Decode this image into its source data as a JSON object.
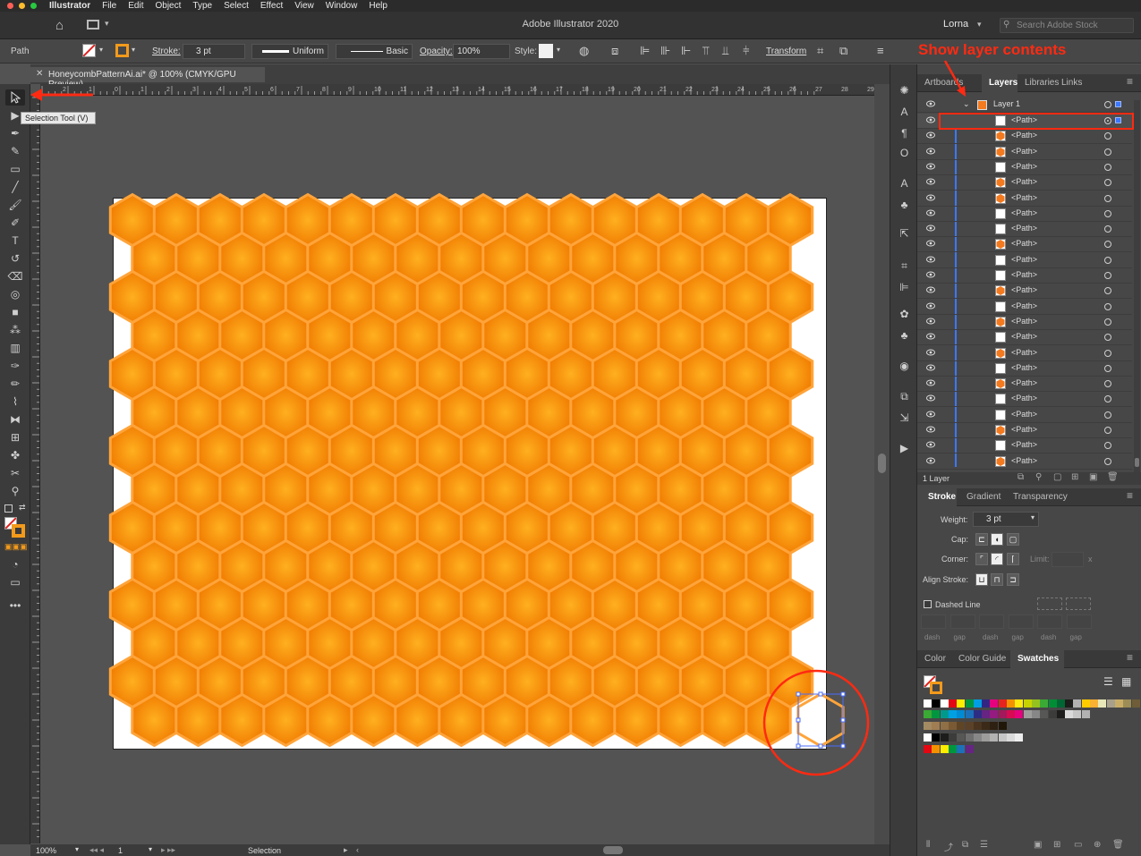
{
  "menubar": {
    "app": "Illustrator",
    "items": [
      "File",
      "Edit",
      "Object",
      "Type",
      "Select",
      "Effect",
      "View",
      "Window",
      "Help"
    ]
  },
  "appbar": {
    "title": "Adobe Illustrator 2020",
    "user": "Lorna",
    "search_placeholder": "Search Adobe Stock"
  },
  "controlbar": {
    "selection_type": "Path",
    "stroke_label": "Stroke:",
    "stroke_weight": "3 pt",
    "profile": "Uniform",
    "brush": "Basic",
    "opacity_label": "Opacity:",
    "opacity": "100%",
    "style_label": "Style:",
    "transform": "Transform"
  },
  "document": {
    "tab_title": "HoneycombPatternAi.ai* @ 100% (CMYK/GPU Preview)"
  },
  "ruler": {
    "h_ticks": [
      "2",
      "1",
      "0",
      "1",
      "2",
      "3",
      "4",
      "5",
      "6",
      "7",
      "8",
      "9",
      "10",
      "11",
      "12",
      "13",
      "14",
      "15",
      "16",
      "17",
      "18",
      "19",
      "20",
      "21",
      "22",
      "23",
      "24",
      "25",
      "26",
      "27",
      "28",
      "29"
    ]
  },
  "tooltip": "Selection Tool (V)",
  "status": {
    "zoom": "100%",
    "artboard": "1",
    "tool": "Selection"
  },
  "layers_panel": {
    "tabs": [
      "Artboards",
      "Layers",
      "Libraries",
      "Links"
    ],
    "active_tab": "Layers",
    "layer_name": "Layer 1",
    "path_label": "<Path>",
    "path_thumbs": [
      "white",
      "hex",
      "hex",
      "white",
      "hex",
      "hex",
      "white",
      "white",
      "hex",
      "white",
      "white",
      "hex",
      "white",
      "hex",
      "white",
      "hex",
      "white",
      "hex",
      "white",
      "white",
      "hex",
      "white",
      "hex"
    ],
    "footer": "1 Layer"
  },
  "stroke_panel": {
    "tabs": [
      "Stroke",
      "Gradient",
      "Transparency"
    ],
    "weight_label": "Weight:",
    "weight": "3 pt",
    "cap_label": "Cap:",
    "corner_label": "Corner:",
    "limit_label": "Limit:",
    "limit_unit": "x",
    "align_label": "Align Stroke:",
    "dashed_label": "Dashed Line",
    "dash_labels": [
      "dash",
      "gap",
      "dash",
      "gap",
      "dash",
      "gap"
    ]
  },
  "swatches_panel": {
    "tabs": [
      "Color",
      "Color Guide",
      "Swatches"
    ],
    "rows": [
      [
        "#ffffff",
        "#000000",
        "#ffffff",
        "#e30613",
        "#ffed00",
        "#00963f",
        "#009fe3",
        "#312783",
        "#e6007e",
        "#e52420",
        "#f39200",
        "#fcea10",
        "#c7d300",
        "#95c11f",
        "#3aaa35",
        "#008d36",
        "#006633",
        "#1d1d1b",
        "#b2b2b2",
        "#ffcc00",
        "#f8b133",
        "#e7e7b7",
        "#a8a08b",
        "#c9ad67",
        "#9c8c55",
        "#6f5d39"
      ],
      [
        "#3aaa35",
        "#009640",
        "#009a8c",
        "#00a0e3",
        "#008bd2",
        "#1d71b8",
        "#2d2e83",
        "#662483",
        "#951b81",
        "#a3195b",
        "#d60b52",
        "#e6007e",
        "#9d9d9c",
        "#878787",
        "#575756",
        "#3c3c3b",
        "#1d1d1b",
        "#dadada",
        "#c6c6c6",
        "#b2b2b2"
      ],
      [
        "#a48a63",
        "#a07d52",
        "#8f6f46",
        "#7a5a35",
        "#5f4526",
        "#5a4128",
        "#4a3420",
        "#3b2a17",
        "#2e2012",
        "#201709"
      ],
      [
        "#ffffff",
        "#000000",
        "#1d1d1b",
        "#3c3c3b",
        "#575756",
        "#706f6f",
        "#878787",
        "#9d9d9c",
        "#b2b2b2",
        "#c6c6c6",
        "#dadada",
        "#ededed"
      ],
      [
        "#e30613",
        "#f39200",
        "#ffed00",
        "#009640",
        "#1d71b8",
        "#662483"
      ]
    ]
  },
  "annotation": {
    "text": "Show layer contents"
  },
  "colors": {
    "hex_fill_center": "#ffb020",
    "hex_fill_edge": "#f07a00",
    "hex_stroke": "#ffa43a",
    "annotation_red": "#ff2a12",
    "selection_blue": "#4a6cff"
  }
}
